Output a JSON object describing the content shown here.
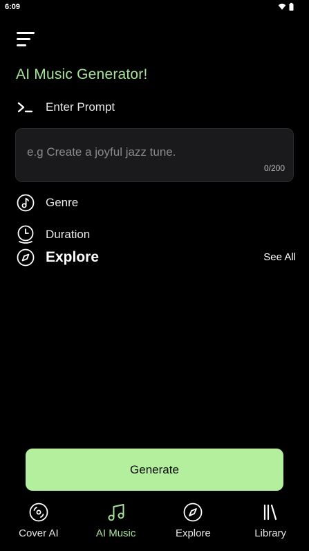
{
  "status_bar": {
    "time": "6:09"
  },
  "header": {
    "title": "AI Music Generator!"
  },
  "prompt": {
    "label": "Enter Prompt",
    "placeholder": "e.g Create a joyful jazz tune.",
    "char_count": "0/200"
  },
  "options": {
    "genre_label": "Genre",
    "duration_label": "Duration"
  },
  "explore": {
    "title": "Explore",
    "see_all": "See All"
  },
  "actions": {
    "generate_label": "Generate"
  },
  "colors": {
    "accent": "#a8e39a",
    "button": "#b4ef9e",
    "background": "#000000"
  },
  "bottom_nav": {
    "items": [
      {
        "label": "Cover AI",
        "icon": "disc-icon"
      },
      {
        "label": "AI Music",
        "icon": "music-note-icon",
        "active": true
      },
      {
        "label": "Explore",
        "icon": "compass-icon"
      },
      {
        "label": "Library",
        "icon": "library-icon"
      }
    ]
  }
}
